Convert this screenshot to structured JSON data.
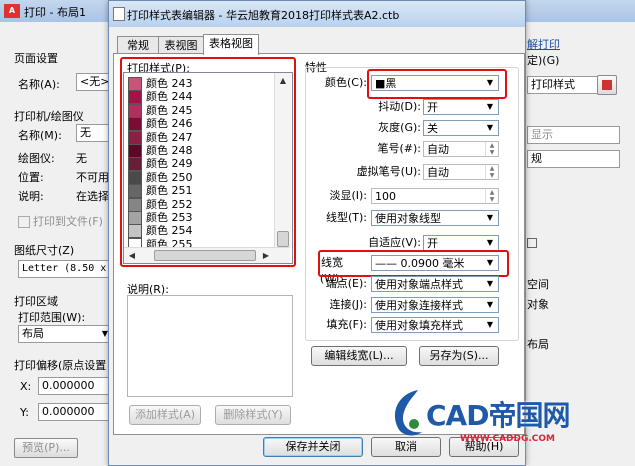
{
  "bg": {
    "title": "打印 - 布局1",
    "page_setup": "页面设置",
    "name_label": "名称(A):",
    "name_value": "<无>",
    "printer_group": "打印机/绘图仪",
    "printer_name_label": "名称(M):",
    "printer_name_value": "无",
    "plotter_label": "绘图仪:",
    "plotter_value": "无",
    "location_label": "位置:",
    "location_value": "不可用",
    "desc_label": "说明:",
    "desc_value": "在选择",
    "print_to_file": "打印到文件(F)",
    "paper_size": "图纸尺寸(Z)",
    "paper_value": "Letter (8.50 x 1",
    "print_area": "打印区域",
    "print_range": "打印范围(W):",
    "print_range_value": "布局",
    "print_offset": "打印偏移(原点设置",
    "x_label": "X:",
    "x_value": "0.000000",
    "y_label": "Y:",
    "y_value": "0.000000",
    "preview_btn": "预览(P)...",
    "right_link": "解打印",
    "right_set": "定)(G)",
    "right_style_combo": "打印样式",
    "right_display": "显示",
    "right_regular": "规",
    "right_space": "空间",
    "right_object": "对象",
    "right_layout": "布局"
  },
  "dialog": {
    "title": "打印样式表编辑器 - 华云旭教育2018打印样式表A2.ctb",
    "tabs": [
      "常规",
      "表视图",
      "表格视图"
    ],
    "styles_label": "打印样式(P):",
    "styles": [
      {
        "name": "颜色 243",
        "color": "#c8547a"
      },
      {
        "name": "颜色 244",
        "color": "#a4124a"
      },
      {
        "name": "颜色 245",
        "color": "#b02f5c"
      },
      {
        "name": "颜色 246",
        "color": "#7d0c34"
      },
      {
        "name": "颜色 247",
        "color": "#8a2145"
      },
      {
        "name": "颜色 248",
        "color": "#5a0a26"
      },
      {
        "name": "颜色 249",
        "color": "#6a1e36"
      },
      {
        "name": "颜色 250",
        "color": "#4a4a4a"
      },
      {
        "name": "颜色 251",
        "color": "#666666"
      },
      {
        "name": "颜色 252",
        "color": "#858585"
      },
      {
        "name": "颜色 253",
        "color": "#a3a3a3"
      },
      {
        "name": "颜色 254",
        "color": "#c4c4c4"
      },
      {
        "name": "颜色 255",
        "color": "#ffffff"
      }
    ],
    "desc_label": "说明(R):",
    "add_style_btn": "添加样式(A)",
    "delete_style_btn": "删除样式(Y)",
    "props_group": "特性",
    "color_label": "颜色(C):",
    "color_value": "■黑",
    "dither_label": "抖动(D):",
    "dither_value": "开",
    "gray_label": "灰度(G):",
    "gray_value": "关",
    "pen_label": "笔号(#):",
    "pen_value": "自动",
    "vpen_label": "虚拟笔号(U):",
    "vpen_value": "自动",
    "fade_label": "淡显(I):",
    "fade_value": "100",
    "linetype_label": "线型(T):",
    "linetype_value": "使用对象线型",
    "adaptive_label": "自适应(V):",
    "adaptive_value": "开",
    "lineweight_label": "线宽(W):",
    "lineweight_value": "—— 0.0900 毫米",
    "endpoint_label": "端点(E):",
    "endpoint_value": "使用对象端点样式",
    "join_label": "连接(J):",
    "join_value": "使用对象连接样式",
    "fill_label": "填充(F):",
    "fill_value": "使用对象填充样式",
    "edit_lw_btn": "编辑线宽(L)...",
    "save_as_btn": "另存为(S)...",
    "save_close_btn": "保存并关闭",
    "cancel_btn": "取消",
    "help_btn": "帮助(H)"
  },
  "watermark": {
    "brand": "CAD帝国网",
    "url": "WWW.CADDG.COM"
  },
  "colors": {
    "highlight_red": "#e01010",
    "title_blue": "#b9d1ee",
    "brand_blue": "#1f5aa8"
  }
}
